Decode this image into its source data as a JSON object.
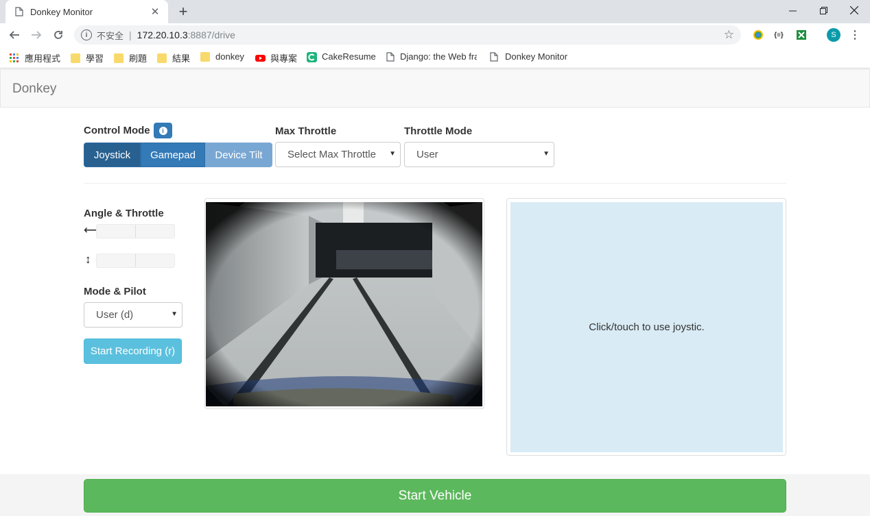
{
  "browser": {
    "tab_title": "Donkey Monitor",
    "tab_close": "✕",
    "new_tab": "+",
    "window_controls": {
      "minimize": "—",
      "restore": "❐",
      "close": "✕"
    },
    "address": {
      "security_label": "不安全",
      "separator": "|",
      "host": "172.20.10.3",
      "path": ":8887/drive"
    },
    "profile_initial": "S",
    "bookmarks": [
      {
        "label": "應用程式",
        "icon": "apps-grid-icon"
      },
      {
        "label": "學習",
        "icon": "folder-icon"
      },
      {
        "label": "刷題",
        "icon": "folder-icon"
      },
      {
        "label": "結果",
        "icon": "folder-icon"
      },
      {
        "label": "donkey",
        "icon": "folder-icon"
      },
      {
        "label": "與專案",
        "icon": "youtube-icon"
      },
      {
        "label": "CakeResume",
        "icon": "cakeresume-icon"
      },
      {
        "label": "Django: the Web fra",
        "icon": "page-icon"
      },
      {
        "label": "Donkey Monitor",
        "icon": "page-icon"
      }
    ]
  },
  "page": {
    "brand": "Donkey",
    "control_mode": {
      "label": "Control Mode",
      "buttons": [
        "Joystick",
        "Gamepad",
        "Device Tilt"
      ],
      "active": "Joystick"
    },
    "max_throttle": {
      "label": "Max Throttle",
      "value": "Select Max Throttle"
    },
    "throttle_mode": {
      "label": "Throttle Mode",
      "value": "User"
    },
    "angle_throttle": {
      "label": "Angle & Throttle",
      "angle_glyph": "⟷",
      "throttle_glyph": "↕"
    },
    "mode_pilot": {
      "label": "Mode & Pilot",
      "value": "User (d)"
    },
    "record_button": "Start Recording (r)",
    "joystick_hint": "Click/touch to use joystic.",
    "start_button": "Start Vehicle"
  },
  "colors": {
    "primary": "#337ab7",
    "primary_active": "#286090",
    "info": "#5bc0de",
    "success": "#5cb85c",
    "joystick_bg": "#d9ebf5"
  }
}
